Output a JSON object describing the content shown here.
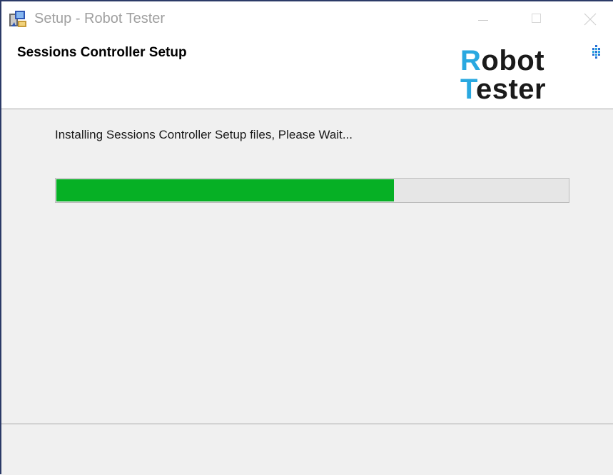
{
  "window": {
    "title": "Setup - Robot Tester",
    "app_icon": "setup-installer-icon",
    "caption_buttons": [
      "minimize-icon",
      "maximize-icon",
      "close-icon"
    ]
  },
  "header": {
    "title": "Sessions Controller Setup",
    "logo": {
      "line1_initial": "R",
      "line1_rest": "obot",
      "line2_initial": "T",
      "line2_rest": "ester",
      "accent_color": "#29a8e0",
      "mark_icon": "dot-grid-logo-icon"
    }
  },
  "main": {
    "status_text": "Installing Sessions Controller Setup files, Please Wait...",
    "progress": {
      "percent": 66,
      "fill_color": "#06b025"
    }
  }
}
